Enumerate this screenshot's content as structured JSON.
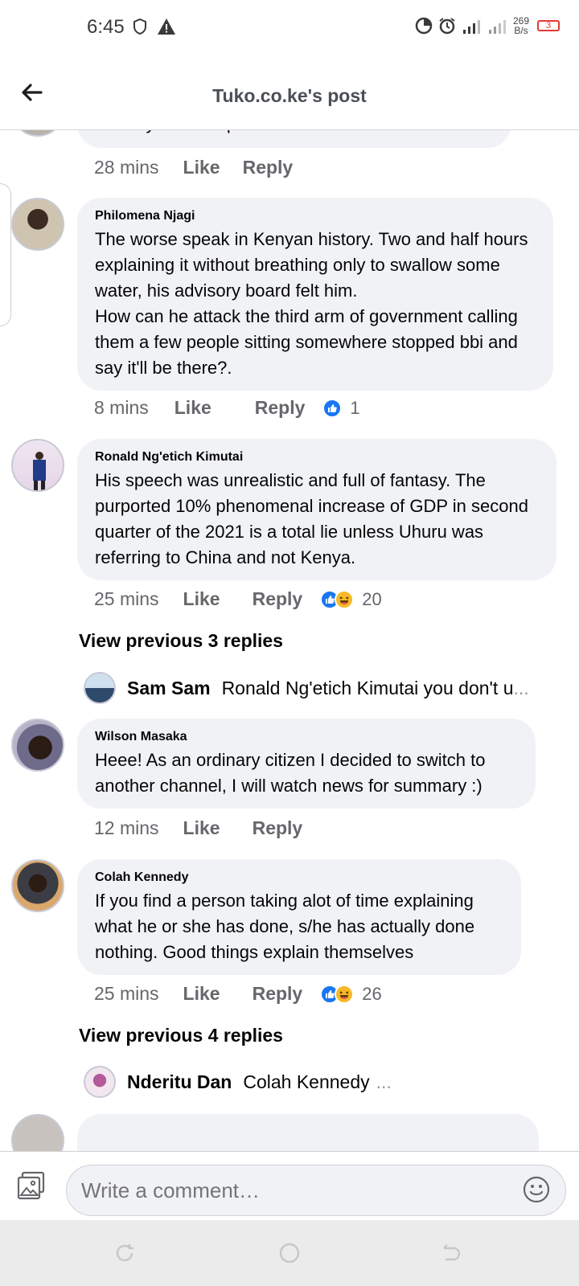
{
  "status_bar": {
    "time": "6:45",
    "net_speed_value": "269",
    "net_speed_unit": "B/s",
    "battery": "3"
  },
  "header": {
    "title": "Tuko.co.ke's post"
  },
  "comments": [
    {
      "partial": true,
      "text": "Chidu ya kutoa speech before the audience",
      "time": "28 mins",
      "like_label": "Like",
      "reply_label": "Reply"
    },
    {
      "author": "Philomena Njagi",
      "text": "The worse speak in Kenyan history. Two and half hours explaining it without breathing only to swallow some water, his advisory board felt him.\nHow can he attack the third arm of government calling them a few people sitting somewhere stopped bbi and say it'll be there?.",
      "time": "8 mins",
      "like_label": "Like",
      "reply_label": "Reply",
      "reaction_count": "1"
    },
    {
      "author": "Ronald Ng'etich Kimutai",
      "text": "His speech was unrealistic and full of fantasy. The purported 10% phenomenal increase of GDP in second quarter of the 2021 is a total lie unless Uhuru was referring to China and not Kenya.",
      "time": "25 mins",
      "like_label": "Like",
      "reply_label": "Reply",
      "reaction_count": "20",
      "view_replies": "View previous 3 replies",
      "reply_preview": {
        "name": "Sam Sam",
        "text": "Ronald Ng'etich Kimutai you don't u",
        "ellipsis": "..."
      }
    },
    {
      "author": "Wilson Masaka",
      "text": "Heee! As an ordinary citizen I decided to switch to another channel, I will watch news for summary :)",
      "time": "12 mins",
      "like_label": "Like",
      "reply_label": "Reply"
    },
    {
      "author": "Colah Kennedy",
      "text": "If you find a person taking alot of time explaining what he or she has done, s/he has actually done nothing. Good things explain themselves",
      "time": "25 mins",
      "like_label": "Like",
      "reply_label": "Reply",
      "reaction_count": "26",
      "view_replies": "View previous 4 replies",
      "reply_preview": {
        "name": "Nderitu Dan",
        "text": "Colah Kennedy",
        "ellipsis": "..."
      }
    }
  ],
  "composer": {
    "placeholder": "Write a comment…"
  },
  "colors": {
    "bubble": "#f0f2f5",
    "like_blue": "#1877f2",
    "haha_yellow": "#f7b928",
    "muted_text": "#65676b"
  },
  "icons": [
    "back-arrow-icon",
    "photo-icon",
    "emoji-icon",
    "shield-icon",
    "warning-icon",
    "like-reaction-icon",
    "haha-reaction-icon"
  ]
}
